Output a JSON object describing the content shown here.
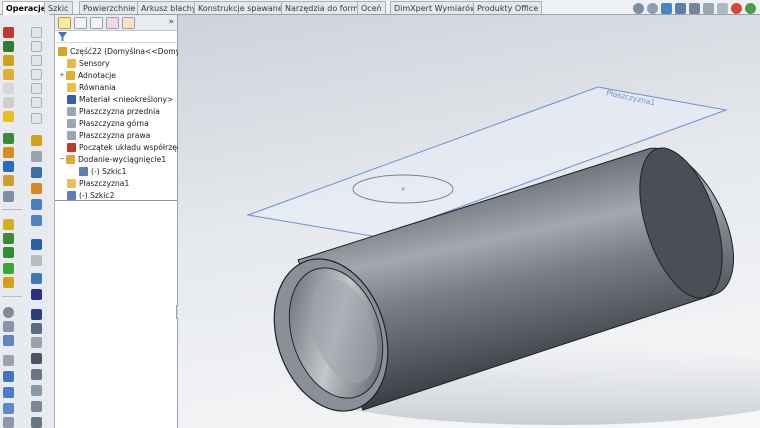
{
  "command_tabs": [
    {
      "label": "Operacje",
      "active": true
    },
    {
      "label": "Szkic",
      "active": false
    },
    {
      "label": "Powierzchnie",
      "active": false
    },
    {
      "label": "Arkusz blachy",
      "active": false
    },
    {
      "label": "Konstrukcje spawane",
      "active": false
    },
    {
      "label": "Narzędzia do form",
      "active": false
    },
    {
      "label": "Oceń",
      "active": false
    },
    {
      "label": "DimXpert Wymiarów",
      "active": false
    },
    {
      "label": "Produkty Office",
      "active": false
    }
  ],
  "feature_manager": {
    "more_glyph": "»",
    "tree": [
      {
        "label": "Część22  (Domyślna<<Domyśln",
        "icon": "part-icon",
        "color": "#d9a520"
      },
      {
        "label": "Sensory",
        "icon": "sensor-folder-icon",
        "color": "#e6b84a"
      },
      {
        "label": "Adnotacje",
        "icon": "annotations-icon",
        "color": "#e0b030",
        "expander": "+"
      },
      {
        "label": "Równania",
        "icon": "equations-icon",
        "color": "#e3c04a"
      },
      {
        "label": "Materiał <nieokreślony>",
        "icon": "material-icon",
        "color": "#3a5fa8"
      },
      {
        "label": "Płaszczyzna przednia",
        "icon": "plane-icon",
        "color": "#9aa6b5"
      },
      {
        "label": "Płaszczyzna górna",
        "icon": "plane-icon",
        "color": "#9aa6b5"
      },
      {
        "label": "Płaszczyzna prawa",
        "icon": "plane-icon",
        "color": "#9aa6b5"
      },
      {
        "label": "Początek układu współrzędn",
        "icon": "origin-icon",
        "color": "#c0392b"
      },
      {
        "label": "Dodanie-wyciągnięcie1",
        "icon": "extrude-icon",
        "color": "#e0a73a",
        "expander": "−"
      },
      {
        "label": "(-) Szkic1",
        "icon": "sketch-icon",
        "color": "#5d7fb5"
      },
      {
        "label": "Płaszczyzna1",
        "icon": "plane-icon",
        "color": "#e2c35a"
      },
      {
        "label": "(-) Szkic2",
        "icon": "sketch-icon",
        "color": "#5d7fb5"
      }
    ]
  },
  "viewport": {
    "plane_label": "Płaszczyzna1",
    "accent_plane": "#6b8fd6",
    "tube_color": "#5b5f66"
  },
  "icons_left": [
    "smart-dimension-icon",
    "extrude-icon",
    "revolve-icon",
    "sweep-icon",
    "loft-icon",
    "fillet-icon",
    "chamfer-icon",
    "rib-icon",
    "shell-icon",
    "draft-icon",
    "hole-icon",
    "pattern-icon",
    "mirror-icon",
    "reference-geometry-icon",
    "curves-icon",
    "instant3d-icon",
    "line-icon",
    "circle-icon",
    "arc-icon",
    "spline-icon",
    "text-icon",
    "note-icon",
    "balloon-icon",
    "surface-finish-icon",
    "weld-symbol-icon",
    "table-icon"
  ],
  "icons_view": [
    "zoom-fit-icon",
    "zoom-area-icon",
    "previous-view-icon",
    "section-view-icon",
    "view-orientation-icon",
    "display-style-icon",
    "hide-show-icon",
    "edit-appearance-icon",
    "apply-scene-icon"
  ]
}
